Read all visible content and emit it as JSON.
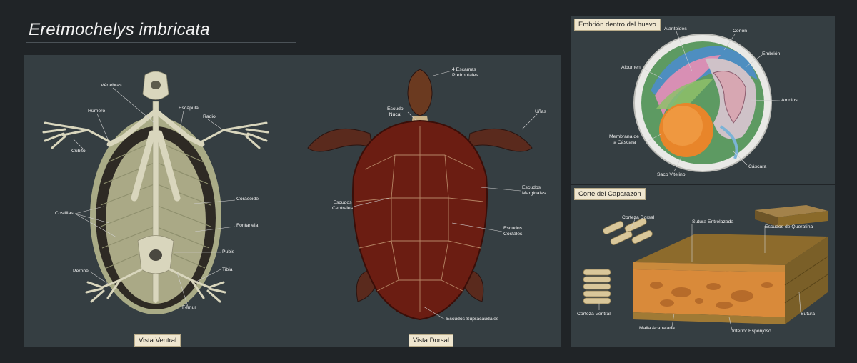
{
  "title": "Eretmochelys imbricata",
  "views": {
    "ventral": "Vista Ventral",
    "dorsal": "Vista Dorsal"
  },
  "skeleton_labels": {
    "vertebras": "Vértebras",
    "humero": "Húmero",
    "escapula": "Escápula",
    "radio": "Radio",
    "cubito": "Cúbito",
    "coracoide": "Coracoide",
    "costillas": "Costillas",
    "fontanela": "Fontanela",
    "pubis": "Pubis",
    "perone": "Peroné",
    "tibia": "Tibia",
    "femur": "Fémur"
  },
  "dorsal_labels": {
    "prefrontales": "4 Escamas\nPrefrontales",
    "nucal": "Escudo\nNucal",
    "unas": "Uñas",
    "centrales": "Escudos\nCentrales",
    "marginales": "Escudos\nMarginales",
    "costales": "Escudos\nCostales",
    "supracaudales": "Escudos Supracaudales"
  },
  "embryo": {
    "title": "Embrión dentro del huevo",
    "labels": {
      "alantoides": "Alantoides",
      "corion": "Corion",
      "embrion": "Embrión",
      "albumen": "Albumen",
      "amnios": "Amnios",
      "membrana": "Membrana de\nla Cáscara",
      "saco": "Saco Vitelino",
      "cascara": "Cáscara"
    }
  },
  "shell_section": {
    "title": "Corte del Caparazón",
    "labels": {
      "corteza_dorsal": "Corteza Dorsal",
      "sutura_entrelazada": "Sutura Entrelazada",
      "escudos_queratina": "Escudos de Queratina",
      "corteza_ventral": "Corteza Ventral",
      "sutura": "Sutura",
      "malla": "Malla Acanalada",
      "interior": "Interior Esponjoso"
    }
  },
  "colors": {
    "background": "#202427",
    "panel": "#353e42",
    "bone": "#d9d6bd",
    "shell_light": "#a9ab86",
    "shell_dark": "#2e2a24",
    "carapace": "#6b1d12",
    "label_bg": "#efe6cf",
    "keratin": "#8a6a2a",
    "spongy": "#d98a3a"
  }
}
